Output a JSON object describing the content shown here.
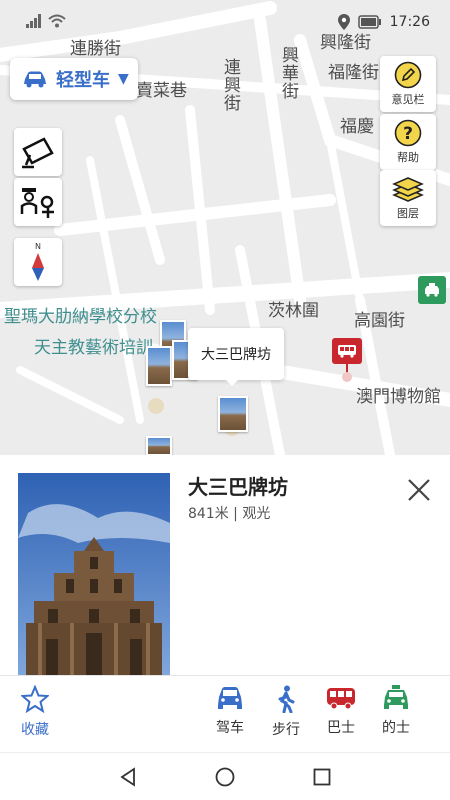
{
  "status": {
    "time": "17:26"
  },
  "vehicle": {
    "label": "轻型车",
    "icon": "car-icon"
  },
  "right_tools": [
    {
      "label": "意见栏",
      "icon": "edit-icon"
    },
    {
      "label": "帮助",
      "icon": "help-icon"
    },
    {
      "label": "图层",
      "icon": "layers-icon"
    }
  ],
  "compass": {
    "north": "N"
  },
  "map_labels": {
    "lianshengjie": "連勝街",
    "maicaixiang": "賣菜巷",
    "lianxingjie": "連興街",
    "xinghuajie": "興華街",
    "xinglongjie": "興隆街",
    "fulongjie": "福隆街",
    "fuqing": "福慶",
    "school1": "聖瑪大肋納學校分校",
    "school2": "天主教藝術培訓",
    "cilinwei": "茨林圍",
    "gaoyuanjie": "高園街",
    "museum": "澳門博物館"
  },
  "poi": {
    "callout": "大三巴牌坊",
    "title": "大三巴牌坊",
    "distance": "841米",
    "category": "观光",
    "separator": " | "
  },
  "actions": {
    "favorite": "收藏",
    "drive": "驾车",
    "walk": "步行",
    "bus": "巴士",
    "taxi": "的士"
  },
  "colors": {
    "accent": "#3a6fc9",
    "taxi_green": "#2e9a5e",
    "bus_red": "#c8282d",
    "map_bg": "#ececec"
  }
}
